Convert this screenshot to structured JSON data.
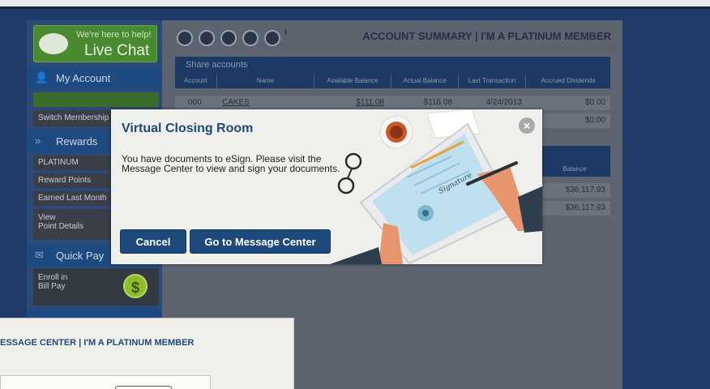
{
  "sidebar": {
    "chat_line1": "We're here to help!",
    "chat_line2": "Live Chat",
    "my_account": "My Account",
    "highlight_item": "",
    "switch_membership": "Switch Membership",
    "rewards": "Rewards",
    "platinum": "PLATINUM",
    "reward_points": "Reward Points",
    "earned_last_month": "Earned Last Month",
    "view_point_details_1": "View",
    "view_point_details_2": "Point Details",
    "quick_pay": "Quick Pay",
    "enroll_1": "Enroll in",
    "enroll_2": "Bill Pay",
    "dollar_symbol": "$"
  },
  "main": {
    "title": "ACCOUNT SUMMARY | I'M A PLATINUM MEMBER",
    "info_symbol": "i",
    "share_caption": "Share accounts",
    "columns": [
      "Account",
      "Name",
      "Available Balance",
      "Actual Balance",
      "Last Transaction",
      "Accrued Dividends"
    ],
    "rows": [
      {
        "account": "000",
        "name": "CAKES",
        "available": "$111.08",
        "actual": "$116.08",
        "last": "4/24/2013",
        "accrued": "$0.00"
      },
      {
        "account": "",
        "name": "",
        "available": "",
        "actual": "",
        "last": "",
        "accrued": "$0.00"
      }
    ],
    "second_col": "Balance",
    "second_rows": [
      "$36,117.93",
      "$36,117.93"
    ]
  },
  "modal": {
    "title": "Virtual Closing Room",
    "body": "You have documents to eSign. Please visit the Message Center to view and sign your documents.",
    "cancel": "Cancel",
    "go": "Go to Message Center",
    "close_symbol": "×",
    "signature_text": "Signature"
  },
  "window2": {
    "title": "ESSAGE CENTER | I'M A PLATINUM MEMBER"
  }
}
